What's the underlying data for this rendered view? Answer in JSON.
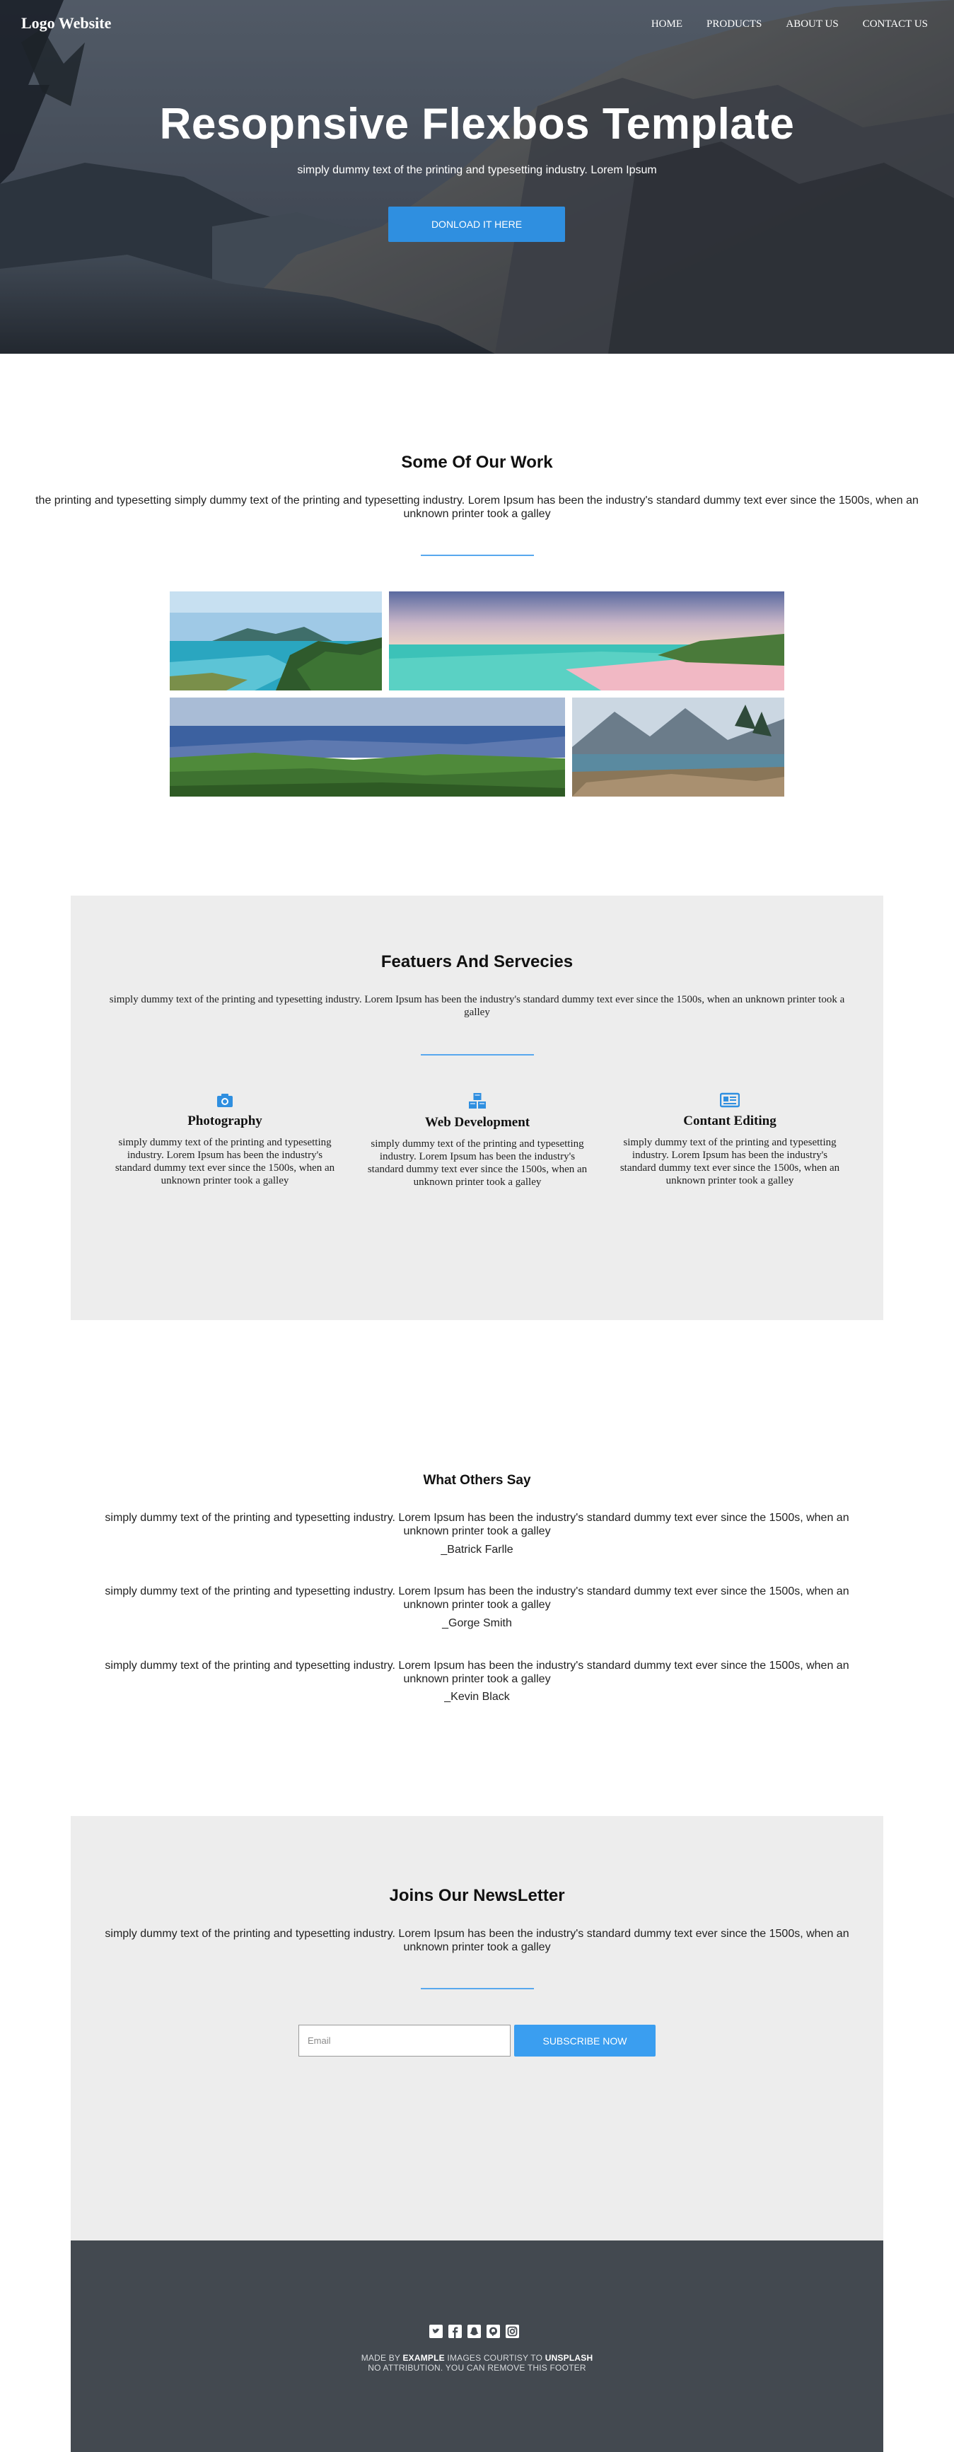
{
  "header": {
    "logo": "Logo Website",
    "nav": [
      "HOME",
      "PRODUCTS",
      "ABOUT US",
      "CONTACT US"
    ]
  },
  "hero": {
    "title": "Resopnsive Flexbos Template",
    "subtitle": "simply dummy text of the printing and typesetting industry. Lorem Ipsum",
    "button": "DONLOAD IT HERE"
  },
  "work": {
    "title": "Some Of Our Work",
    "text": "the printing and typesetting simply dummy text of the printing and typesetting industry. Lorem Ipsum has been the industry's standard dummy text ever since the 1500s, when an unknown printer took a galley",
    "images": [
      "tropical-island-photo",
      "pink-beach-photo",
      "coastal-hills-photo",
      "mountain-lake-photo"
    ]
  },
  "features": {
    "title": "Featuers And Servecies",
    "text": "simply dummy text of the printing and typesetting industry. Lorem Ipsum has been the industry's standard dummy text ever since the 1500s, when an unknown printer took a galley",
    "items": [
      {
        "icon": "camera-icon",
        "name": "Photography",
        "text": "simply dummy text of the printing and typesetting industry. Lorem Ipsum has been the industry's standard dummy text ever since the 1500s, when an unknown printer took a galley"
      },
      {
        "icon": "cubes-icon",
        "name": "Web Development",
        "text": "simply dummy text of the printing and typesetting industry. Lorem Ipsum has been the industry's standard dummy text ever since the 1500s, when an unknown printer took a galley"
      },
      {
        "icon": "newspaper-icon",
        "name": "Contant Editing",
        "text": "simply dummy text of the printing and typesetting industry. Lorem Ipsum has been the industry's standard dummy text ever since the 1500s, when an unknown printer took a galley"
      }
    ]
  },
  "testimonials": {
    "title": "What Others Say",
    "items": [
      {
        "text": "simply dummy text of the printing and typesetting industry. Lorem Ipsum has been the industry's standard dummy text ever since the 1500s, when an unknown printer took a galley",
        "author": "_Batrick Farlle"
      },
      {
        "text": "simply dummy text of the printing and typesetting industry. Lorem Ipsum has been the industry's standard dummy text ever since the 1500s, when an unknown printer took a galley",
        "author": "_Gorge Smith"
      },
      {
        "text": "simply dummy text of the printing and typesetting industry. Lorem Ipsum has been the industry's standard dummy text ever since the 1500s, when an unknown printer took a galley",
        "author": "_Kevin Black"
      }
    ]
  },
  "newsletter": {
    "title": "Joins Our NewsLetter",
    "text": "simply dummy text of the printing and typesetting industry. Lorem Ipsum has been the industry's standard dummy text ever since the 1500s, when an unknown printer took a galley",
    "email_placeholder": "Email",
    "button": "SUBSCRIBE NOW"
  },
  "footer": {
    "social_icons": [
      "twitter-icon",
      "facebook-icon",
      "snapchat-icon",
      "pinterest-icon",
      "instagram-icon"
    ],
    "made_by_prefix": "MADE BY",
    "made_by_brand": "EXAMPLE",
    "images_courtesy": "IMAGES COURTISY TO",
    "images_source": "UNSPLASH",
    "attribution": "NO ATTRIBUTION. YOU CAN REMOVE THIS FOOTER"
  },
  "colors": {
    "accent": "#2f8fe0",
    "divider": "#58a8ee",
    "panel": "#ededed",
    "footer": "#434950"
  }
}
